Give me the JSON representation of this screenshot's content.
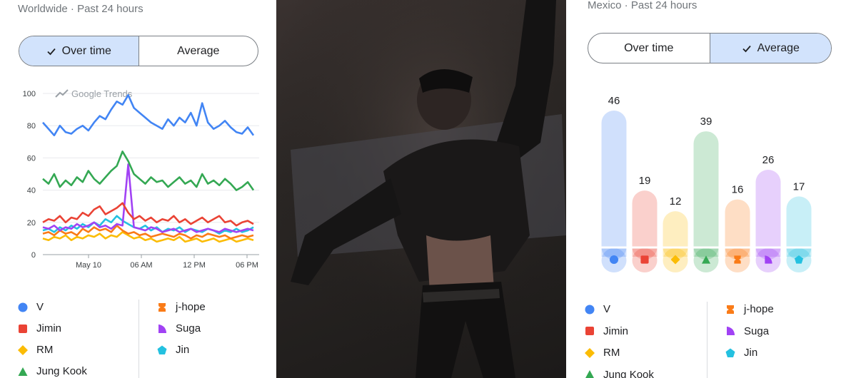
{
  "left_panel": {
    "subtitle": "Worldwide · Past 24 hours",
    "toggle": {
      "over_time": "Over time",
      "average": "Average",
      "selected": "over_time"
    },
    "watermark": "Google Trends"
  },
  "right_panel": {
    "subtitle": "Mexico · Past 24 hours",
    "toggle": {
      "over_time": "Over time",
      "average": "Average",
      "selected": "average"
    }
  },
  "legend": [
    {
      "name": "V",
      "color": "#4285f4",
      "icon": "circle-icon"
    },
    {
      "name": "Jimin",
      "color": "#ea4335",
      "icon": "square-icon"
    },
    {
      "name": "RM",
      "color": "#fbbc04",
      "icon": "diamond-icon"
    },
    {
      "name": "Jung Kook",
      "color": "#34a853",
      "icon": "triangle-icon"
    },
    {
      "name": "j-hope",
      "color": "#fa7b17",
      "icon": "hourglass-icon"
    },
    {
      "name": "Suga",
      "color": "#a142f4",
      "icon": "quarter-shape-icon"
    },
    {
      "name": "Jin",
      "color": "#24c1e0",
      "icon": "pentagon-icon"
    }
  ],
  "chart_data": [
    {
      "type": "line",
      "x_tick_labels": [
        "May 10",
        "06 AM",
        "12 PM",
        "06 PM"
      ],
      "y_ticks": [
        0,
        20,
        40,
        60,
        80,
        100
      ],
      "ylim": [
        0,
        100
      ],
      "grid": true,
      "series": [
        {
          "name": "V",
          "values": [
            82,
            78,
            74,
            80,
            76,
            75,
            78,
            80,
            77,
            82,
            86,
            84,
            90,
            95,
            93,
            99,
            91,
            88,
            85,
            82,
            80,
            78,
            84,
            80,
            85,
            82,
            88,
            80,
            94,
            82,
            78,
            80,
            83,
            79,
            76,
            75,
            79,
            74
          ]
        },
        {
          "name": "Jung Kook",
          "values": [
            47,
            44,
            50,
            42,
            46,
            43,
            48,
            45,
            52,
            47,
            44,
            48,
            52,
            55,
            64,
            58,
            50,
            47,
            44,
            48,
            45,
            46,
            42,
            45,
            48,
            44,
            46,
            42,
            50,
            44,
            46,
            43,
            47,
            44,
            40,
            42,
            45,
            40
          ]
        },
        {
          "name": "Jimin",
          "values": [
            20,
            22,
            21,
            24,
            20,
            23,
            22,
            26,
            24,
            28,
            30,
            25,
            27,
            29,
            32,
            26,
            22,
            24,
            21,
            23,
            20,
            22,
            21,
            24,
            20,
            22,
            19,
            21,
            23,
            20,
            22,
            24,
            20,
            21,
            18,
            20,
            21,
            19
          ]
        },
        {
          "name": "Suga",
          "values": [
            17,
            16,
            18,
            15,
            17,
            16,
            19,
            17,
            18,
            20,
            17,
            18,
            16,
            19,
            18,
            56,
            17,
            16,
            15,
            17,
            16,
            14,
            15,
            16,
            14,
            15,
            16,
            14,
            15,
            16,
            15,
            14,
            16,
            15,
            14,
            15,
            16,
            15
          ]
        },
        {
          "name": "Jin",
          "values": [
            15,
            16,
            14,
            17,
            15,
            18,
            16,
            19,
            17,
            20,
            18,
            22,
            20,
            24,
            21,
            19,
            17,
            16,
            18,
            15,
            17,
            14,
            16,
            15,
            17,
            14,
            16,
            15,
            14,
            16,
            15,
            13,
            15,
            14,
            16,
            14,
            15,
            17
          ]
        },
        {
          "name": "j-hope",
          "values": [
            13,
            14,
            12,
            15,
            13,
            14,
            12,
            16,
            14,
            17,
            15,
            16,
            14,
            18,
            15,
            13,
            14,
            12,
            13,
            11,
            12,
            13,
            12,
            11,
            13,
            12,
            10,
            12,
            11,
            13,
            12,
            11,
            12,
            10,
            11,
            12,
            11,
            12
          ]
        },
        {
          "name": "RM",
          "values": [
            10,
            9,
            11,
            10,
            12,
            9,
            11,
            10,
            12,
            11,
            13,
            10,
            12,
            11,
            14,
            12,
            10,
            11,
            9,
            10,
            8,
            9,
            10,
            9,
            11,
            8,
            9,
            10,
            8,
            9,
            10,
            8,
            9,
            10,
            8,
            9,
            10,
            9
          ]
        }
      ]
    },
    {
      "type": "bar",
      "categories": [
        "V",
        "Jimin",
        "RM",
        "Jung Kook",
        "j-hope",
        "Suga",
        "Jin"
      ],
      "values": [
        46,
        19,
        12,
        39,
        16,
        26,
        17
      ]
    }
  ]
}
